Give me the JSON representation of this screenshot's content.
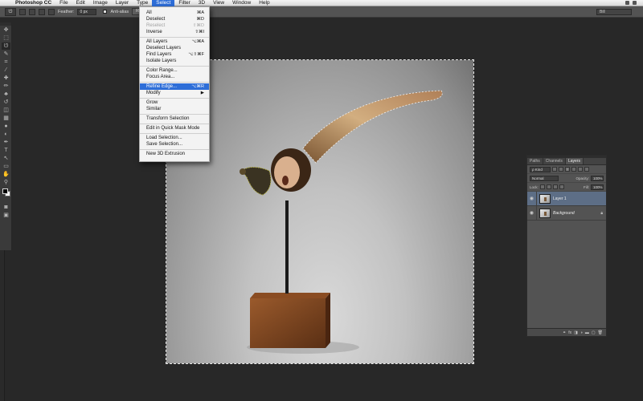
{
  "menubar": {
    "items": [
      {
        "label": "Photoshop CC",
        "app": true
      },
      {
        "label": "File"
      },
      {
        "label": "Edit"
      },
      {
        "label": "Image"
      },
      {
        "label": "Layer"
      },
      {
        "label": "Type"
      },
      {
        "label": "Select",
        "active": true
      },
      {
        "label": "Filter"
      },
      {
        "label": "3D"
      },
      {
        "label": "View"
      },
      {
        "label": "Window"
      },
      {
        "label": "Help"
      }
    ]
  },
  "options": {
    "feather_label": "Feather:",
    "feather_value": "0 px",
    "antialias_label": "Anti-alias",
    "refine_label": "Refi",
    "workspace": "Bill"
  },
  "select_menu": {
    "items": [
      {
        "label": "All",
        "shortcut": "⌘A"
      },
      {
        "label": "Deselect",
        "shortcut": "⌘D"
      },
      {
        "label": "Reselect",
        "shortcut": "⇧⌘D",
        "disabled": true
      },
      {
        "label": "Inverse",
        "shortcut": "⇧⌘I"
      },
      {
        "sep": true
      },
      {
        "label": "All Layers",
        "shortcut": "⌥⌘A"
      },
      {
        "label": "Deselect Layers",
        "shortcut": ""
      },
      {
        "label": "Find Layers",
        "shortcut": "⌥⇧⌘F"
      },
      {
        "label": "Isolate Layers",
        "shortcut": ""
      },
      {
        "sep": true
      },
      {
        "label": "Color Range...",
        "shortcut": ""
      },
      {
        "label": "Focus Area...",
        "shortcut": ""
      },
      {
        "sep": true
      },
      {
        "label": "Refine Edge...",
        "shortcut": "⌥⌘R",
        "highlight": true
      },
      {
        "label": "Modify",
        "shortcut": "▶"
      },
      {
        "sep": true
      },
      {
        "label": "Grow",
        "shortcut": ""
      },
      {
        "label": "Similar",
        "shortcut": ""
      },
      {
        "sep": true
      },
      {
        "label": "Transform Selection",
        "shortcut": ""
      },
      {
        "sep": true
      },
      {
        "label": "Edit in Quick Mask Mode",
        "shortcut": ""
      },
      {
        "sep": true
      },
      {
        "label": "Load Selection...",
        "shortcut": ""
      },
      {
        "label": "Save Selection...",
        "shortcut": ""
      },
      {
        "sep": true
      },
      {
        "label": "New 3D Extrusion",
        "shortcut": ""
      }
    ]
  },
  "layers_panel": {
    "tabs": [
      "Paths",
      "Channels",
      "Layers"
    ],
    "active_tab": "Layers",
    "filter_kind": "ρ Kind",
    "blend_mode": "Normal",
    "opacity_label": "Opacity:",
    "opacity_value": "100%",
    "lock_label": "Lock:",
    "fill_label": "Fill:",
    "fill_value": "100%",
    "layers": [
      {
        "name": "Layer 1",
        "selected": true,
        "italic": false,
        "locked": false
      },
      {
        "name": "Background",
        "selected": false,
        "italic": true,
        "locked": true
      }
    ],
    "footer_icons": [
      "link-icon",
      "fx-icon",
      "mask-icon",
      "adjustment-icon",
      "group-icon",
      "new-layer-icon",
      "trash-icon"
    ]
  },
  "toolbox": {
    "tools": [
      "move-icon",
      "marquee-icon",
      "lasso-icon",
      "quick-select-icon",
      "crop-icon",
      "eyedropper-icon",
      "healing-icon",
      "brush-icon",
      "stamp-icon",
      "history-brush-icon",
      "eraser-icon",
      "gradient-icon",
      "blur-icon",
      "dodge-icon",
      "pen-icon",
      "type-icon",
      "path-select-icon",
      "shape-icon",
      "hand-icon",
      "zoom-icon"
    ],
    "glyphs": [
      "✥",
      "⬚",
      "ᘎ",
      "✎",
      "⌗",
      "⁄",
      "✚",
      "✏",
      "♣",
      "↺",
      "◫",
      "▦",
      "●",
      "◐",
      "✒",
      "T",
      "↖",
      "▭",
      "✋",
      "⚲"
    ],
    "selected_index": 2
  }
}
